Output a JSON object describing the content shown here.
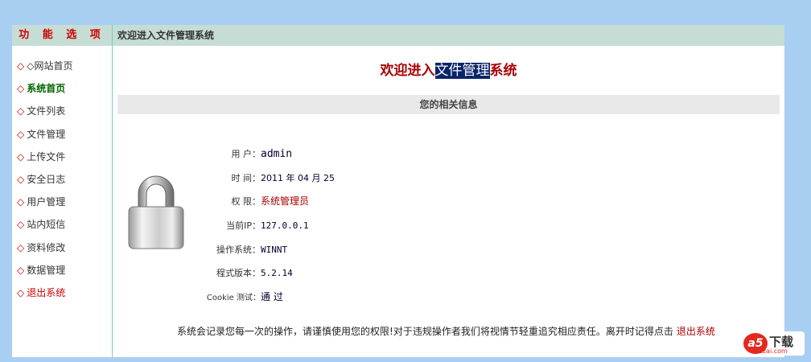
{
  "sidebar": {
    "title": "功 能 选 项",
    "items": [
      {
        "label": "◇网站首页"
      },
      {
        "label": "系统首页"
      },
      {
        "label": "文件列表"
      },
      {
        "label": "文件管理"
      },
      {
        "label": "上传文件"
      },
      {
        "label": "安全日志"
      },
      {
        "label": "用户管理"
      },
      {
        "label": "站内短信"
      },
      {
        "label": "资料修改"
      },
      {
        "label": "数据管理"
      },
      {
        "label": "退出系统"
      }
    ]
  },
  "main": {
    "header": "欢迎进入文件管理系统",
    "welcome": {
      "prefix": "欢迎进入",
      "highlight": "文件管理",
      "suffix": "系统"
    },
    "info_title": "您的相关信息",
    "rows": [
      {
        "label": "用 户：",
        "value": "admin"
      },
      {
        "label": "时 间：",
        "value": "2011 年 04 月 25"
      },
      {
        "label": "权 限：",
        "value": "系统管理员"
      },
      {
        "label": "当前IP：",
        "value": "127.0.0.1"
      },
      {
        "label": "操作系统：",
        "value": "WINNT"
      },
      {
        "label": "程式版本：",
        "value": "5.2.14"
      },
      {
        "label": "Cookie 测试：",
        "value": "通 过"
      }
    ],
    "footer_text": "系统会记录您每一次的操作，请谨慎使用您的权限!对于违规操作者我们将视情节轻重追究相应责任。离开时记得点击",
    "footer_link": "退出系统"
  },
  "watermark": {
    "logo": "a5",
    "text": "下载",
    "site": "xiazai.com"
  },
  "colors": {
    "background": "#a8cff2",
    "header": "#c6ddd5",
    "accent": "#cc0000",
    "active": "#006600"
  }
}
